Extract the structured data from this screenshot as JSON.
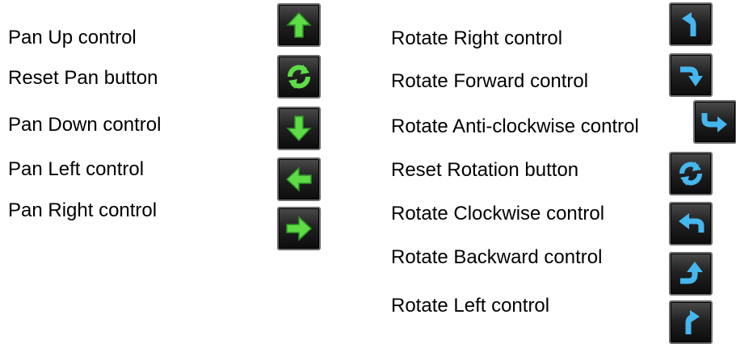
{
  "pan": {
    "up": {
      "label": "Pan Up control",
      "icon": "arrow-up-icon",
      "color": "#5ddc46"
    },
    "reset": {
      "label": "Reset Pan button",
      "icon": "refresh-icon",
      "color": "#5ddc46"
    },
    "down": {
      "label": "Pan Down control",
      "icon": "arrow-down-icon",
      "color": "#5ddc46"
    },
    "left": {
      "label": "Pan Left control",
      "icon": "arrow-left-icon",
      "color": "#5ddc46"
    },
    "right": {
      "label": "Pan Right control",
      "icon": "arrow-right-icon",
      "color": "#5ddc46"
    }
  },
  "rotate": {
    "right": {
      "label": "Rotate Right control",
      "icon": "rotate-right-icon",
      "color": "#45b6ee"
    },
    "forward": {
      "label": "Rotate Forward control",
      "icon": "rotate-forward-icon",
      "color": "#45b6ee"
    },
    "anticlockwise": {
      "label": "Rotate Anti-clockwise control",
      "icon": "rotate-anticlockwise-icon",
      "color": "#45b6ee"
    },
    "reset": {
      "label": "Reset Rotation button",
      "icon": "refresh-icon",
      "color": "#45b6ee"
    },
    "clockwise": {
      "label": "Rotate Clockwise control",
      "icon": "rotate-clockwise-icon",
      "color": "#45b6ee"
    },
    "backward": {
      "label": "Rotate Backward control",
      "icon": "rotate-backward-icon",
      "color": "#45b6ee"
    },
    "left": {
      "label": "Rotate Left control",
      "icon": "rotate-left-icon",
      "color": "#45b6ee"
    }
  }
}
